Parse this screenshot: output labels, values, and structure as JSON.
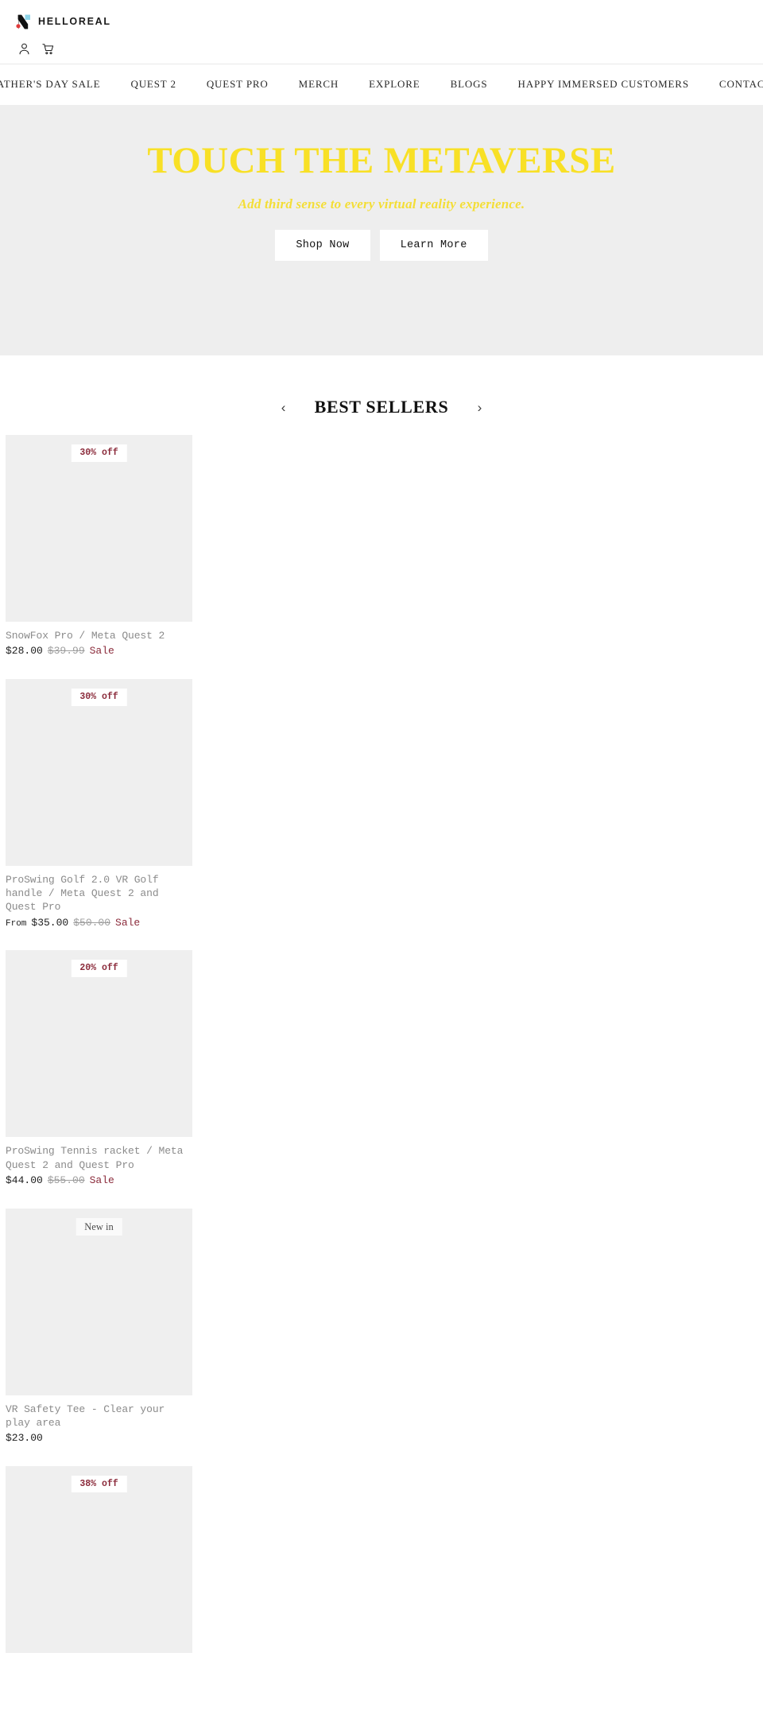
{
  "header": {
    "brand_name": "HELLOREAL",
    "logo_icon": "helloreal-n-logo",
    "account_icon": "user-account-icon",
    "cart_icon": "shopping-cart-icon",
    "colors": {
      "logo_black": "#111111",
      "logo_blue": "#8ed4e8",
      "logo_red": "#e03a3a"
    }
  },
  "nav": {
    "items": [
      {
        "label": "FATHER'S DAY SALE"
      },
      {
        "label": "QUEST 2"
      },
      {
        "label": "QUEST PRO"
      },
      {
        "label": "MERCH"
      },
      {
        "label": "EXPLORE"
      },
      {
        "label": "BLOGS"
      },
      {
        "label": "HAPPY IMMERSED CUSTOMERS"
      },
      {
        "label": "CONTACT"
      }
    ]
  },
  "hero": {
    "title": "TOUCH THE METAVERSE",
    "subtitle": "Add third sense to every virtual reality experience.",
    "primary_button": "Shop Now",
    "secondary_button": "Learn More",
    "background_color": "#eeeeee",
    "title_color": "#f8e026"
  },
  "best_sellers": {
    "title": "BEST SELLERS",
    "prev_arrow": "‹",
    "next_arrow": "›",
    "products": [
      {
        "badge": "30% off",
        "badge_type": "sale",
        "title": "SnowFox Pro / Meta Quest 2",
        "price_from": "",
        "price": "$28.00",
        "compare_at": "$39.99",
        "tag": "Sale"
      },
      {
        "badge": "30% off",
        "badge_type": "sale",
        "title": "ProSwing Golf 2.0 VR Golf handle / Meta Quest 2 and Quest Pro",
        "price_from": "From",
        "price": "$35.00",
        "compare_at": "$50.00",
        "tag": "Sale"
      },
      {
        "badge": "20% off",
        "badge_type": "sale",
        "title": "ProSwing Tennis racket / Meta Quest 2 and Quest Pro",
        "price_from": "",
        "price": "$44.00",
        "compare_at": "$55.00",
        "tag": "Sale"
      },
      {
        "badge": "New in",
        "badge_type": "new",
        "title": "VR Safety Tee - Clear your play area",
        "price_from": "",
        "price": "$23.00",
        "compare_at": "",
        "tag": ""
      },
      {
        "badge": "38% off",
        "badge_type": "sale",
        "title": "",
        "price_from": "",
        "price": "",
        "compare_at": "",
        "tag": ""
      }
    ]
  }
}
